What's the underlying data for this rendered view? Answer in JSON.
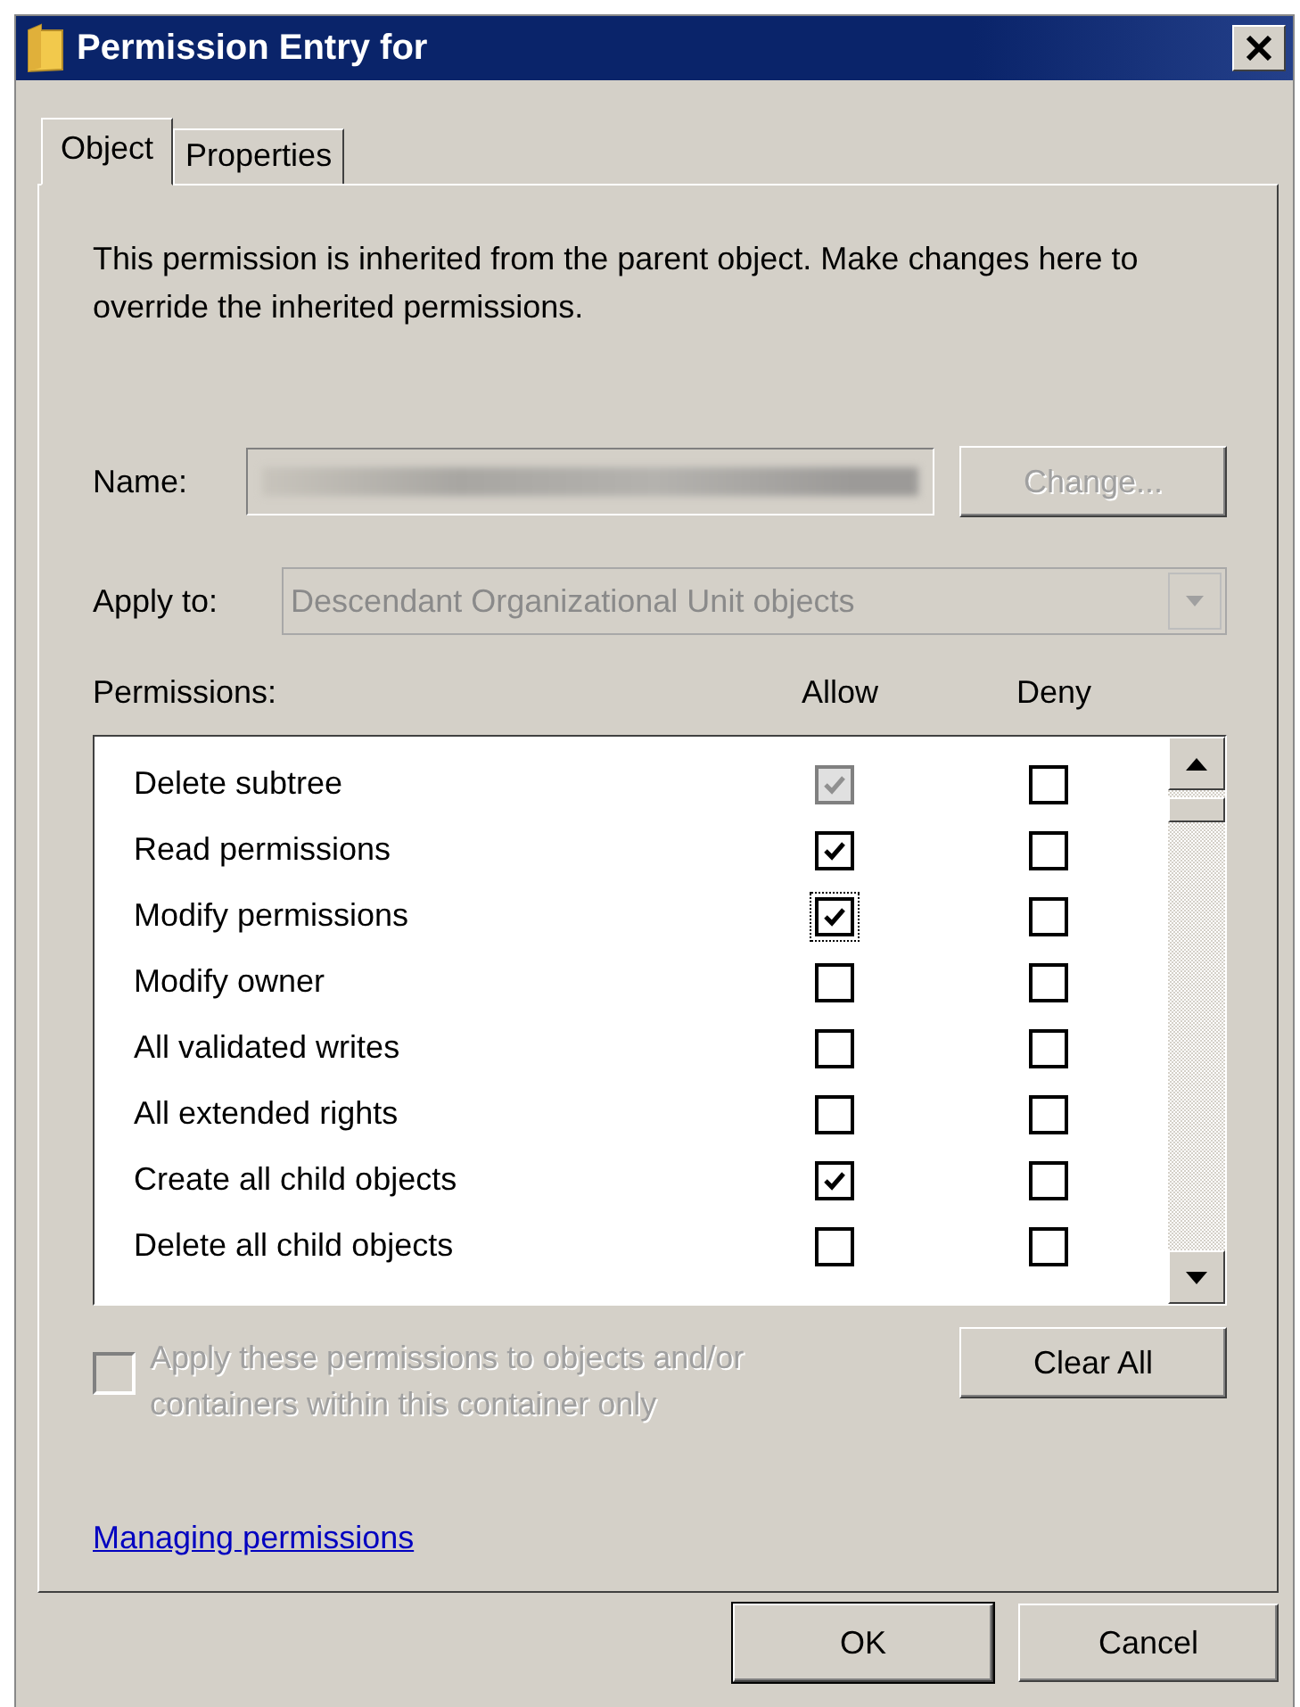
{
  "window": {
    "title": "Permission Entry for"
  },
  "tabs": [
    {
      "label": "Object",
      "selected": true
    },
    {
      "label": "Properties",
      "selected": false
    }
  ],
  "info_text": "This permission is inherited from the parent object. Make changes here to override the inherited permissions.",
  "name_row": {
    "label": "Name:",
    "change_button": {
      "label": "Change...",
      "disabled": true
    }
  },
  "apply_to": {
    "label": "Apply to:",
    "value": "Descendant Organizational Unit objects",
    "disabled": true
  },
  "permissions": {
    "label": "Permissions:",
    "columns": [
      "Allow",
      "Deny"
    ],
    "rows": [
      {
        "name": "Delete subtree",
        "allow": true,
        "allow_disabled": true,
        "allow_focused": false,
        "deny": false
      },
      {
        "name": "Read permissions",
        "allow": true,
        "allow_disabled": false,
        "allow_focused": false,
        "deny": false
      },
      {
        "name": "Modify permissions",
        "allow": true,
        "allow_disabled": false,
        "allow_focused": true,
        "deny": false
      },
      {
        "name": "Modify owner",
        "allow": false,
        "allow_disabled": false,
        "allow_focused": false,
        "deny": false
      },
      {
        "name": "All validated writes",
        "allow": false,
        "allow_disabled": false,
        "allow_focused": false,
        "deny": false
      },
      {
        "name": "All extended rights",
        "allow": false,
        "allow_disabled": false,
        "allow_focused": false,
        "deny": false
      },
      {
        "name": "Create all child objects",
        "allow": true,
        "allow_disabled": false,
        "allow_focused": false,
        "deny": false
      },
      {
        "name": "Delete all child objects",
        "allow": false,
        "allow_disabled": false,
        "allow_focused": false,
        "deny": false
      }
    ]
  },
  "apply_children": {
    "label": "Apply these permissions to objects and/or containers within this container only",
    "checked": false,
    "disabled": true
  },
  "clear_all_button": "Clear All",
  "help_link": "Managing permissions",
  "buttons": [
    {
      "label": "OK",
      "default": true
    },
    {
      "label": "Cancel",
      "default": false
    }
  ]
}
